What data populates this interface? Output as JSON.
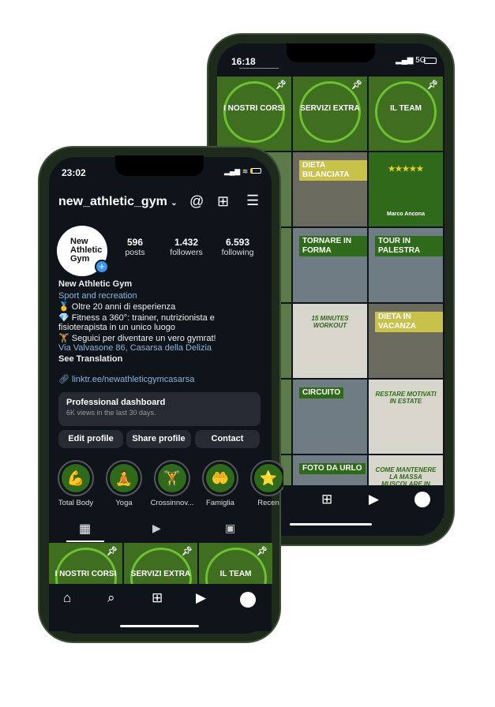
{
  "back_phone": {
    "time": "16:18",
    "network": "5G",
    "grid": [
      {
        "text": "I NOSTRI CORSI",
        "style": "ring",
        "pinned": true
      },
      {
        "text": "SERVIZI EXTRA",
        "style": "ring",
        "pinned": true
      },
      {
        "text": "IL TEAM",
        "style": "ring",
        "pinned": true
      },
      {
        "text": "",
        "style": "photo"
      },
      {
        "text": "DIETA BILANCIATA",
        "style": "label"
      },
      {
        "text": "Marco Ancona",
        "style": "review"
      },
      {
        "text": "",
        "style": "photo"
      },
      {
        "text": "TORNARE IN FORMA",
        "style": "labelg"
      },
      {
        "text": "TOUR IN PALESTRA",
        "style": "labelg"
      },
      {
        "text": "",
        "style": "photo"
      },
      {
        "text": "15 MINUTES WORKOUT",
        "style": "paper"
      },
      {
        "text": "DIETA IN VACANZA",
        "style": "label"
      },
      {
        "text": "",
        "style": "photo"
      },
      {
        "text": "CIRCUITO",
        "style": "labelg"
      },
      {
        "text": "RESTARE MOTIVATI IN ESTATE",
        "style": "paper"
      },
      {
        "text": "",
        "style": "photo"
      },
      {
        "text": "FOTO DA URLO",
        "style": "labelg"
      },
      {
        "text": "COME MANTENERE LA MASSA MUSCOLARE IN VACANZA",
        "style": "paper"
      }
    ]
  },
  "front_phone": {
    "time": "23:02",
    "username": "new_athletic_gym",
    "avatar_text": "New Athletic Gym",
    "stats": [
      {
        "value": "596",
        "label": "posts"
      },
      {
        "value": "1.432",
        "label": "followers"
      },
      {
        "value": "6.593",
        "label": "following"
      }
    ],
    "name": "New Athletic Gym",
    "category": "Sport and recreation",
    "bio": [
      "🥇 Oltre 20 anni di esperienza",
      "💎 Fitness a 360°: trainer, nutrizionista e",
      "fisioterapista in un unico luogo",
      "🏋 Seguici per diventare un vero gymrat!"
    ],
    "address": "Via Valvasone 86, Casarsa della Delizia",
    "see_translation": "See Translation",
    "link": "linktr.ee/newathleticgymcasarsa",
    "dashboard": {
      "title": "Professional dashboard",
      "subtitle": "6K views in the last 30 days."
    },
    "buttons": {
      "edit": "Edit profile",
      "share": "Share profile",
      "contact": "Contact"
    },
    "highlights": [
      {
        "label": "Total Body",
        "icon": "💪"
      },
      {
        "label": "Yoga",
        "icon": "🧘"
      },
      {
        "label": "Crossinnov...",
        "icon": "🏋"
      },
      {
        "label": "Famiglia",
        "icon": "🤲"
      },
      {
        "label": "Recen",
        "icon": "⭐"
      }
    ],
    "grid": [
      "I NOSTRI CORSI",
      "SERVIZI EXTRA",
      "IL TEAM"
    ],
    "accent": "#3897f0"
  }
}
